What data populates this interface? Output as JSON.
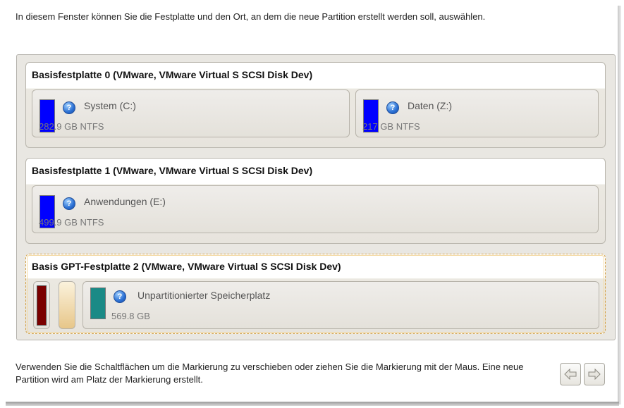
{
  "intro_text": "In diesem Fenster können Sie die Festplatte und den Ort, an dem die neue Partition erstellt werden soll, auswählen.",
  "disks": [
    {
      "title": "Basisfestplatte 0 (VMware, VMware Virtual S SCSI Disk Dev)",
      "partitions": [
        {
          "name": "System (C:)",
          "size": "282.9 GB NTFS",
          "color": "#0000ff",
          "help_icon": "question-icon"
        },
        {
          "name": "Daten (Z:)",
          "size": "217 GB NTFS",
          "color": "#0000ff",
          "help_icon": "question-icon"
        }
      ]
    },
    {
      "title": "Basisfestplatte 1 (VMware, VMware Virtual S SCSI Disk Dev)",
      "partitions": [
        {
          "name": "Anwendungen (E:)",
          "size": "499.9 GB NTFS",
          "color": "#0000ff",
          "help_icon": "question-icon"
        }
      ]
    },
    {
      "title": "Basis GPT-Festplatte 2 (VMware, VMware Virtual S SCSI Disk Dev)",
      "selected": true,
      "mini_partitions": [
        {
          "color": "#7a0000"
        },
        {
          "color": "#e7c689"
        }
      ],
      "partitions": [
        {
          "name": "Unpartitionierter Speicherplatz",
          "size": "569.8 GB",
          "color": "#1a8a86",
          "help_icon": "question-icon"
        }
      ]
    }
  ],
  "hint_text": "Verwenden Sie die Schaltflächen um die Markierung zu verschieben oder ziehen Sie die Markierung mit der Maus. Eine neue Partition wird am Platz der Markierung erstellt.",
  "nav": {
    "left_icon": "arrow-left-icon",
    "right_icon": "arrow-right-icon"
  }
}
